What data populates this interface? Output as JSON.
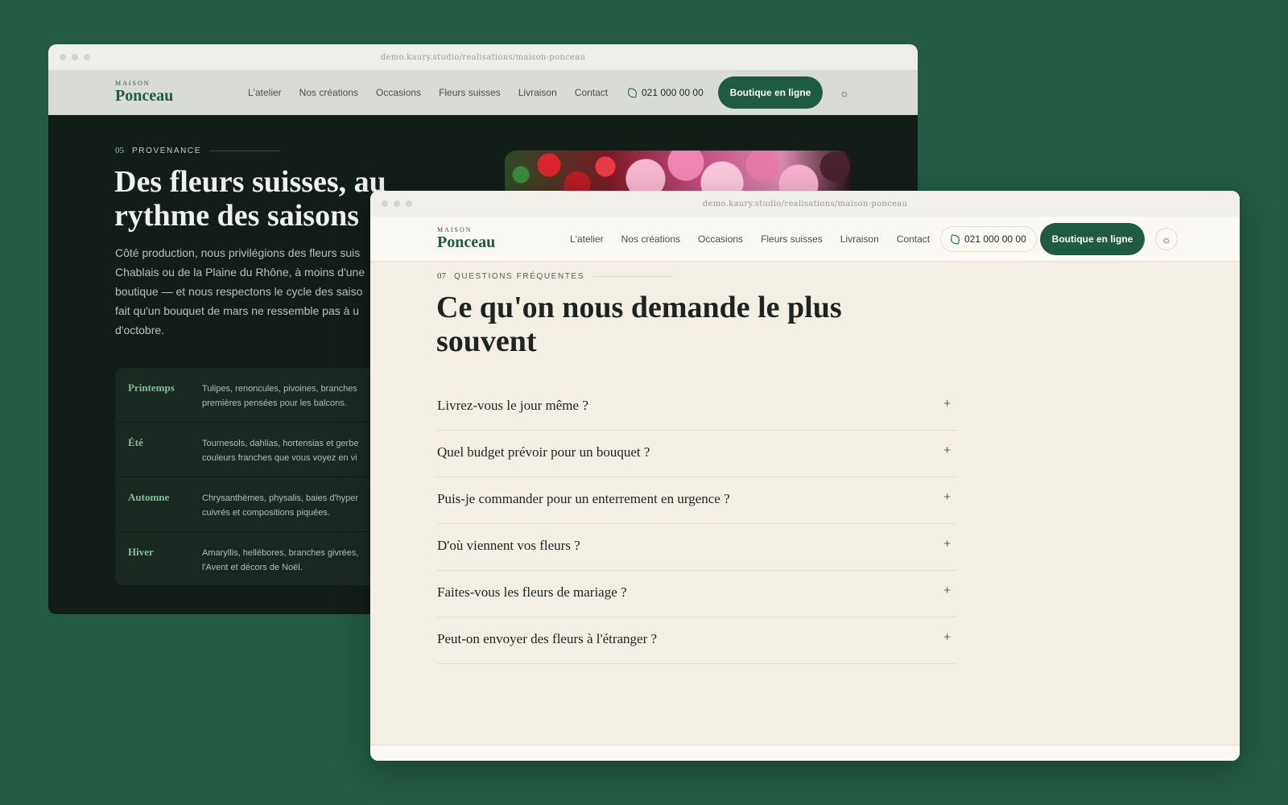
{
  "colors": {
    "background": "#225a43",
    "accent": "#1f5a43",
    "dark_page": "#121d18",
    "light_page": "#f4efe5"
  },
  "back_window": {
    "url": "demo.kaury.studio/realisations/maison-ponceau",
    "logo": {
      "small": "MAISON",
      "big": "Ponceau"
    },
    "menu": [
      "L'atelier",
      "Nos créations",
      "Occasions",
      "Fleurs suisses",
      "Livraison",
      "Contact"
    ],
    "phone": "021 000 00 00",
    "shop_button": "Boutique en ligne",
    "theme_icon": "☼",
    "eyebrow": {
      "num": "05",
      "label": "PROVENANCE"
    },
    "title": "Des fleurs suisses, au rythme des saisons",
    "paragraph_lines": [
      "Côté production, nous privilégions des fleurs suis",
      "Chablais ou de la Plaine du Rhône, à moins d'une",
      "boutique — et nous respectons le cycle des saiso",
      "fait qu'un bouquet de mars ne ressemble pas à u",
      "d'octobre."
    ],
    "seasons": [
      {
        "name": "Printemps",
        "line1": "Tulipes, renoncules, pivoines, branches",
        "line2": "premières pensées pour les balcons."
      },
      {
        "name": "Été",
        "line1": "Tournesols, dahlias, hortensias et gerbe",
        "line2": "couleurs franches que vous voyez en vi"
      },
      {
        "name": "Automne",
        "line1": "Chrysanthèmes, physalis, baies d'hyper",
        "line2": "cuivrés et compositions piquées."
      },
      {
        "name": "Hiver",
        "line1": "Amaryllis, hellébores, branches givrées,",
        "line2": "l'Avent et décors de Noël."
      }
    ]
  },
  "front_window": {
    "url": "demo.kaury.studio/realisations/maison-ponceau",
    "logo": {
      "small": "MAISON",
      "big": "Ponceau"
    },
    "menu": [
      "L'atelier",
      "Nos créations",
      "Occasions",
      "Fleurs suisses",
      "Livraison",
      "Contact"
    ],
    "phone": "021 000 00 00",
    "shop_button": "Boutique en ligne",
    "theme_icon": "☼",
    "eyebrow": {
      "num": "07",
      "label": "QUESTIONS FRÉQUENTES"
    },
    "title": "Ce qu'on nous demande le plus souvent",
    "faq": [
      {
        "q": "Livrez-vous le jour même ?",
        "icon": "+"
      },
      {
        "q": "Quel budget prévoir pour un bouquet ?",
        "icon": "+"
      },
      {
        "q": "Puis-je commander pour un enterrement en urgence ?",
        "icon": "+"
      },
      {
        "q": "D'où viennent vos fleurs ?",
        "icon": "+"
      },
      {
        "q": "Faites-vous les fleurs de mariage ?",
        "icon": "+"
      },
      {
        "q": "Peut-on envoyer des fleurs à l'étranger ?",
        "icon": "+"
      }
    ]
  }
}
